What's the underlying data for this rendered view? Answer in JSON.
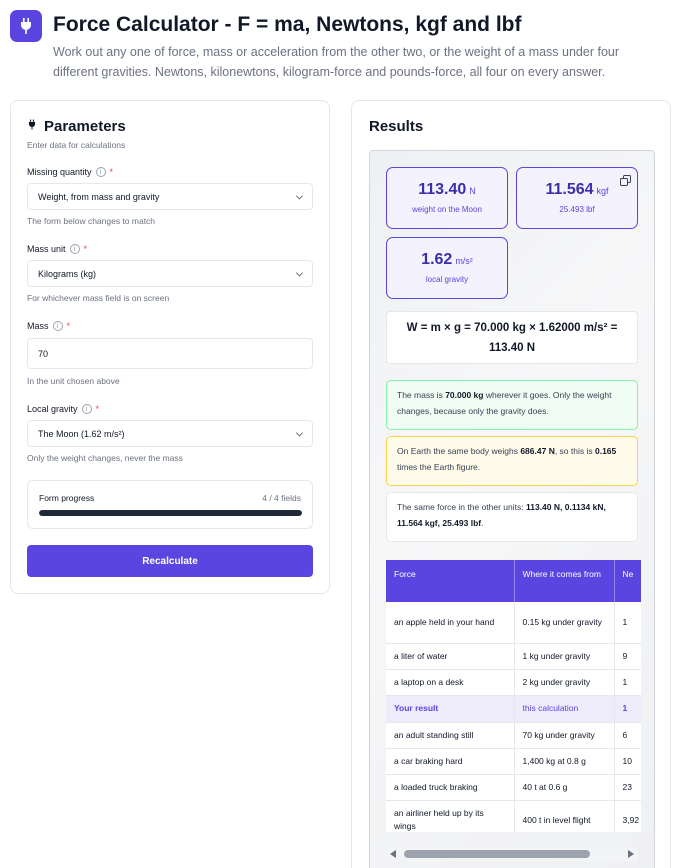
{
  "header": {
    "title": "Force Calculator - F = ma, Newtons, kgf and lbf",
    "subtitle": "Work out any one of force, mass or acceleration from the other two, or the weight of a mass under four different gravities. Newtons, kilonewtons, kilogram-force and pounds-force, all four on every answer.",
    "icon": "plug-icon"
  },
  "params": {
    "title": "Parameters",
    "subtitle": "Enter data for calculations",
    "icon": "plug-icon",
    "missing_quantity": {
      "label": "Missing quantity",
      "required": "*",
      "value": "Weight, from mass and gravity",
      "hint": "The form below changes to match"
    },
    "mass_unit": {
      "label": "Mass unit",
      "required": "*",
      "value": "Kilograms (kg)",
      "hint": "For whichever mass field is on screen"
    },
    "mass": {
      "label": "Mass",
      "required": "*",
      "value": "70",
      "hint": "In the unit chosen above"
    },
    "local_gravity": {
      "label": "Local gravity",
      "required": "*",
      "value": "The Moon (1.62 m/s²)",
      "hint": "Only the weight changes, never the mass"
    },
    "progress": {
      "label": "Form progress",
      "count": "4 / 4 fields",
      "fraction": 1.0
    },
    "recalc_label": "Recalculate"
  },
  "results": {
    "title": "Results",
    "cards": [
      {
        "value": "113.40",
        "unit": "N",
        "caption": "weight on the Moon"
      },
      {
        "value": "11.564",
        "unit": "kgf",
        "caption": "25.493 lbf"
      },
      {
        "value": "1.62",
        "unit": "m/s²",
        "caption": "local gravity"
      }
    ],
    "formula_line1": "W = m × g = 70.000 kg × 1.62000 m/s² =",
    "formula_line2": "113.40 N",
    "note_green": {
      "pre": "The mass is ",
      "bold": "70.000 kg",
      "post": " wherever it goes. Only the weight changes, because only the gravity does."
    },
    "note_amber": {
      "pre": "On Earth the same body weighs ",
      "bold1": "686.47 N",
      "mid": ", so this is ",
      "bold2": "0.165",
      "post": " times the Earth figure."
    },
    "note_white": {
      "pre": "The same force in the other units: ",
      "bold": "113.40 N, 0.1134 kN, 11.564 kgf, 25.493 lbf",
      "post": "."
    },
    "table": {
      "headers": [
        "Force",
        "Where it comes from",
        "Ne"
      ],
      "rows": [
        [
          "an apple held in your hand",
          "0.15 kg under gravity",
          "1"
        ],
        [
          "a liter of water",
          "1 kg under gravity",
          "9"
        ],
        [
          "a laptop on a desk",
          "2 kg under gravity",
          "1"
        ],
        [
          "Your result",
          "this calculation",
          "1"
        ],
        [
          "an adult standing still",
          "70 kg under gravity",
          "6"
        ],
        [
          "a car braking hard",
          "1,400 kg at 0.8 g",
          "10"
        ],
        [
          "a loaded truck braking",
          "40 t at 0.6 g",
          "23"
        ],
        [
          "an airliner held up by its wings",
          "400 t in level flight",
          "3,92"
        ]
      ]
    }
  },
  "colors": {
    "accent": "#5b45e0",
    "green": "#86efac",
    "amber": "#fcd34d"
  }
}
